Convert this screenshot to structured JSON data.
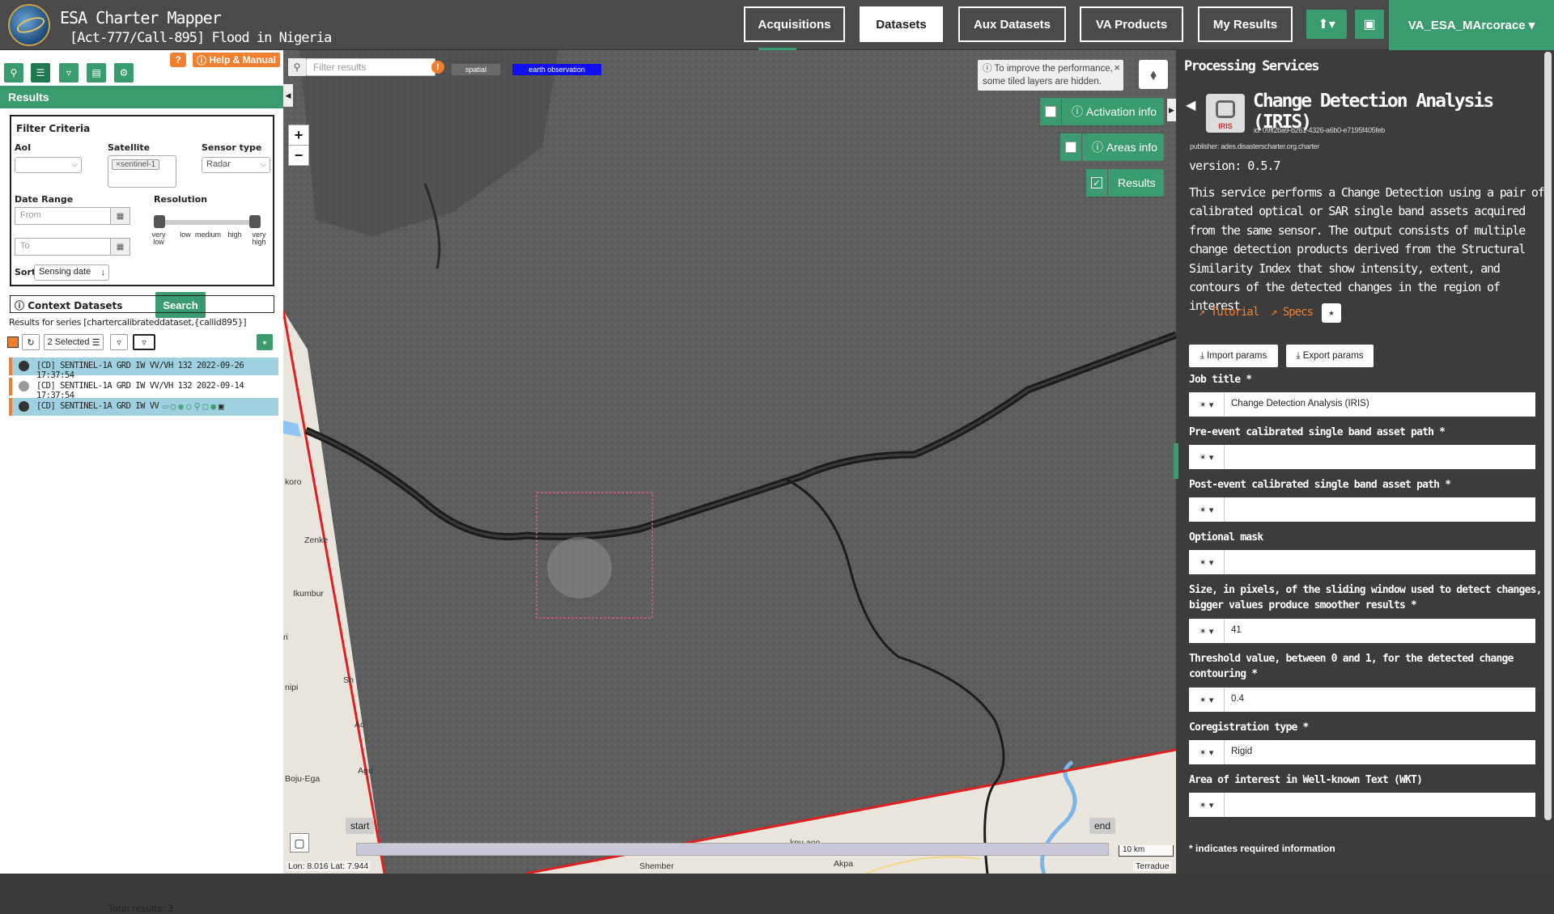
{
  "app": {
    "title": "ESA Charter Mapper",
    "subtitle": "[Act-777/Call-895] Flood in Nigeria"
  },
  "nav": {
    "tabs": [
      "Acquisitions",
      "Datasets",
      "Aux Datasets",
      "VA Products",
      "My Results"
    ],
    "active": "Datasets",
    "user": "VA_ESA_MArcorace ▾"
  },
  "left": {
    "help_label": "Help & Manual",
    "help_qmark": "?",
    "results_header": "Results",
    "filter": {
      "title": "Filter Criteria",
      "aoi_label": "AoI",
      "satellite_label": "Satellite",
      "satellite_chip": "×sentinel-1",
      "sensor_label": "Sensor type",
      "sensor_value": "Radar",
      "date_label": "Date Range",
      "from_placeholder": "From",
      "to_placeholder": "To",
      "resolution_label": "Resolution",
      "res_levels": [
        "very low",
        "low",
        "medium",
        "high",
        "very high"
      ],
      "sort_label": "Sort",
      "sort_value": "Sensing date",
      "search_label": "Search"
    },
    "context_label": "Context Datasets",
    "series_info": "Results for series [chartercalibrateddataset,{callid895}]",
    "selected_label": "2 Selected",
    "results": [
      {
        "title": "[CD] SENTINEL-1A GRD IW VV/VH 132 2022-09-26 17:37:54",
        "selected": true
      },
      {
        "title": "[CD] SENTINEL-1A GRD IW VV/VH 132 2022-09-14 17:37:54",
        "selected": false
      },
      {
        "title": "[CD] SENTINEL-1A GRD IW VV",
        "selected": true
      }
    ],
    "total_results": "Total results: 3"
  },
  "map": {
    "filter_placeholder": "Filter results",
    "tag_spatial": "spatial",
    "tag_eo": "earth observation",
    "perf_note": "To improve the performance, some tiled layers are hidden.",
    "overlays": [
      "Activation info",
      "Areas info",
      "Results"
    ],
    "timeline_start": "start",
    "timeline_end": "end",
    "scale": "10 km",
    "coords": "Lon: 8.016 Lat: 7.944",
    "attribution": "Terradue",
    "places": [
      "koro",
      "Zenke",
      "Ikumbur",
      "Boju-Ega",
      "Shember",
      "Akpa",
      "nipi",
      "Agu",
      "Sh",
      "Ac",
      "ri",
      "kpu.aoo"
    ]
  },
  "right": {
    "panel_title": "Processing Services",
    "service_icon_text": "IRIS",
    "service_title": "Change Detection Analysis (IRIS)",
    "service_id": "id: 09ff2ba9-b261-4326-a6b0-e7195f405feb",
    "publisher": "publisher: ades.disasterscharter.org.charter",
    "version": "version: 0.5.7",
    "description": "This service performs a Change Detection using a pair of calibrated optical or SAR single band assets acquired from the same sensor. The output consists of multiple change detection products derived from the Structural Similarity Index that show intensity, extent, and contours of the detected changes in the region of interest",
    "tutorial_label": "Tutorial",
    "specs_label": "Specs",
    "import_label": "Import params",
    "export_label": "Export params",
    "fields": [
      {
        "label": "Job title *",
        "value": "Change Detection Analysis (IRIS)"
      },
      {
        "label": "Pre-event calibrated single band asset path *",
        "value": ""
      },
      {
        "label": "Post-event calibrated single band asset path *",
        "value": ""
      },
      {
        "label": "Optional mask",
        "value": ""
      },
      {
        "label": "Size, in pixels, of the sliding window used to detect changes, bigger values produce smoother results *",
        "value": "41"
      },
      {
        "label": "Threshold value, between 0 and 1, for the detected change contouring *",
        "value": "0.4"
      },
      {
        "label": "Coregistration type *",
        "value": "Rigid"
      },
      {
        "label": "Area of interest in Well-known Text (WKT)",
        "value": ""
      }
    ],
    "required_note": "* indicates required information"
  },
  "colors": {
    "accent": "#3a9b6e",
    "warning": "#f08030",
    "panel": "#3c3c3c"
  }
}
